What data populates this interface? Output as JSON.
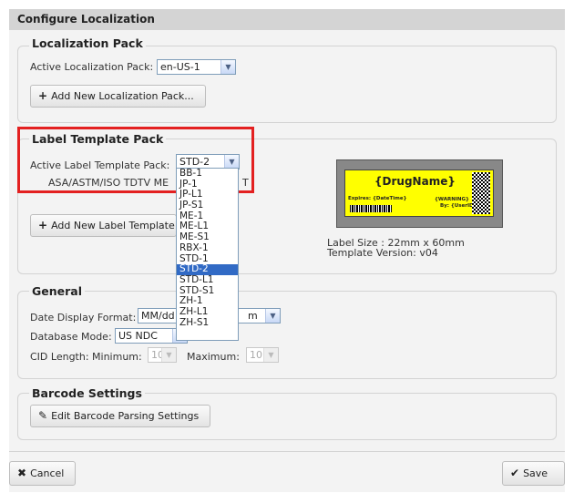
{
  "dialog": {
    "title": "Configure Localization"
  },
  "localization": {
    "legend": "Localization Pack",
    "active_label": "Active Localization Pack:",
    "active_value": "en-US-1",
    "add_button": "Add New Localization Pack..."
  },
  "label_template": {
    "legend": "Label Template Pack",
    "active_label": "Active Label Template Pack:",
    "active_value": "STD-2",
    "format_text": "ASA/ASTM/ISO TDTV ME",
    "format_text_tail": "T",
    "add_button": "Add New Label Template",
    "options": [
      "BB-1",
      "JP-1",
      "JP-L1",
      "JP-S1",
      "ME-1",
      "ME-L1",
      "ME-S1",
      "RBX-1",
      "STD-1",
      "STD-2",
      "STD-L1",
      "STD-S1",
      "ZH-1",
      "ZH-L1",
      "ZH-S1"
    ],
    "selected_option": "STD-2",
    "preview": {
      "drug_name": "{DrugName}",
      "expires": "Expires: {DateTime}",
      "warning": "{WARNING}",
      "by": "By: {UserID}"
    },
    "label_size": "Label Size : 22mm x 60mm",
    "template_version": "Template Version: v04"
  },
  "general": {
    "legend": "General",
    "date_format_label": "Date Display Format:",
    "date_format_value": "MM/dd",
    "date_format_tail": "m",
    "db_mode_label": "Database Mode:",
    "db_mode_value": "US NDC",
    "cid_label": "CID Length: Minimum:",
    "cid_min": "10",
    "cid_max_label": "Maximum:",
    "cid_max": "10"
  },
  "barcode": {
    "legend": "Barcode Settings",
    "edit_button": "Edit Barcode Parsing Settings"
  },
  "footer": {
    "cancel": "Cancel",
    "save": "Save"
  },
  "colors": {
    "highlight": "#e32020",
    "selected": "#316ac5",
    "label_yellow": "#ffff00"
  }
}
